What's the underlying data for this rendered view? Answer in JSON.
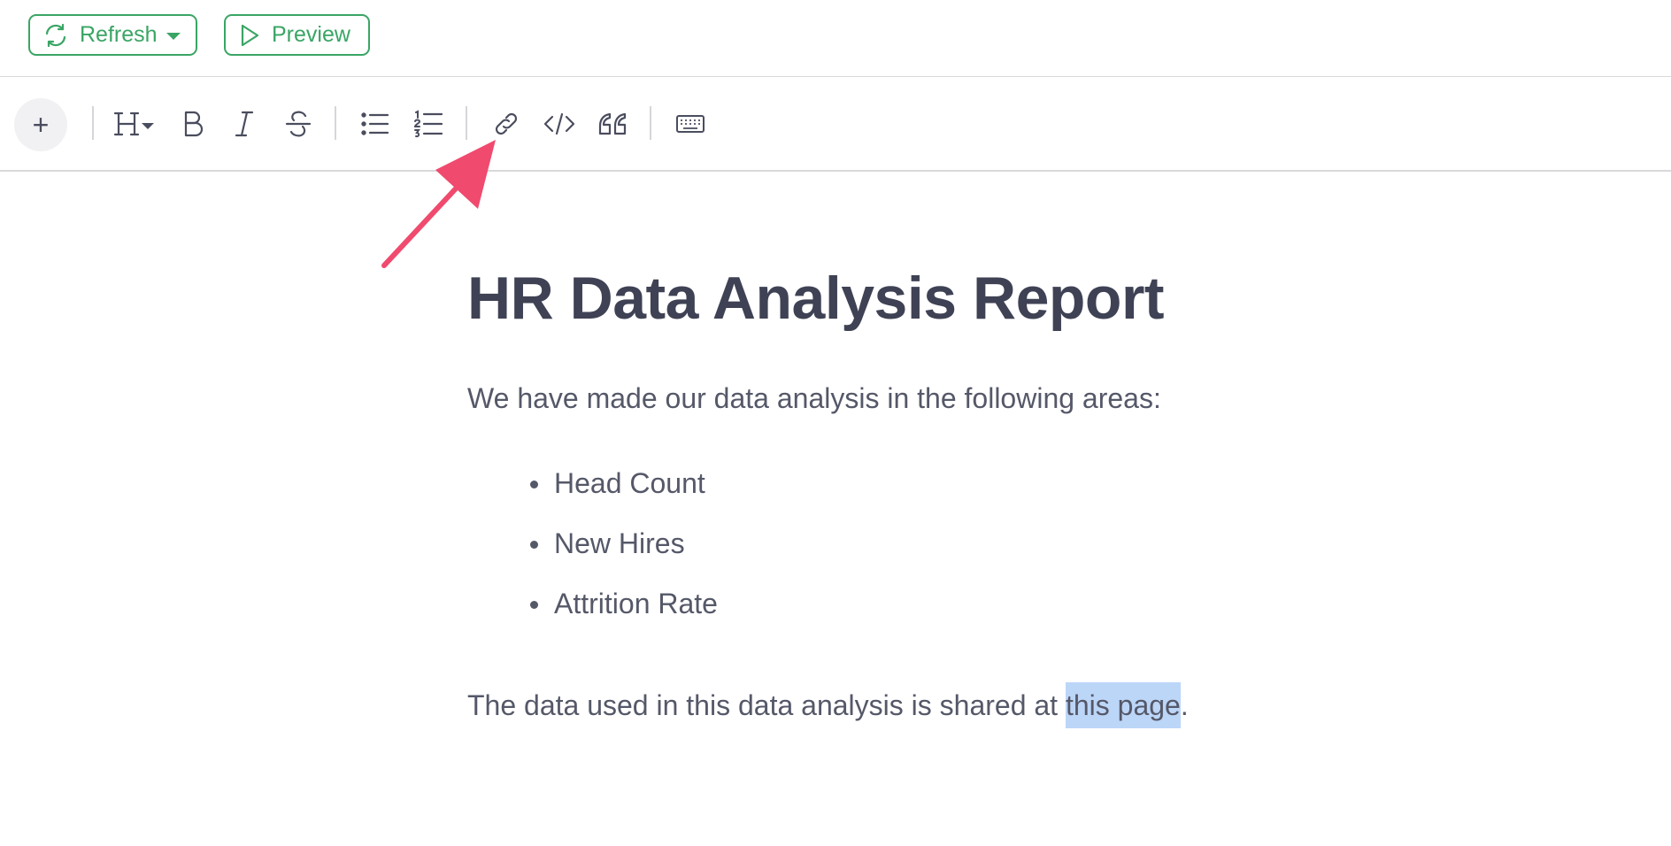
{
  "top_bar": {
    "refresh_label": "Refresh",
    "preview_label": "Preview",
    "accent_color": "#3aa565"
  },
  "toolbar": {
    "add_label": "+",
    "items": [
      "heading-icon",
      "bold-icon",
      "italic-icon",
      "strikethrough-icon",
      "bulleted-list-icon",
      "numbered-list-icon",
      "link-icon",
      "code-icon",
      "quote-icon",
      "keyboard-icon"
    ]
  },
  "document": {
    "title": "HR Data Analysis Report",
    "intro": "We have made our data analysis in the following areas:",
    "bullets": [
      "Head Count",
      "New Hires",
      "Attrition Rate"
    ],
    "data_sentence_prefix": "The data used in this data analysis is shared at ",
    "data_sentence_link": "this page",
    "data_sentence_suffix": "."
  },
  "annotation": {
    "arrow_color": "#f04a6e",
    "points_to": "link-icon",
    "selection_color": "#bcd6f8"
  }
}
